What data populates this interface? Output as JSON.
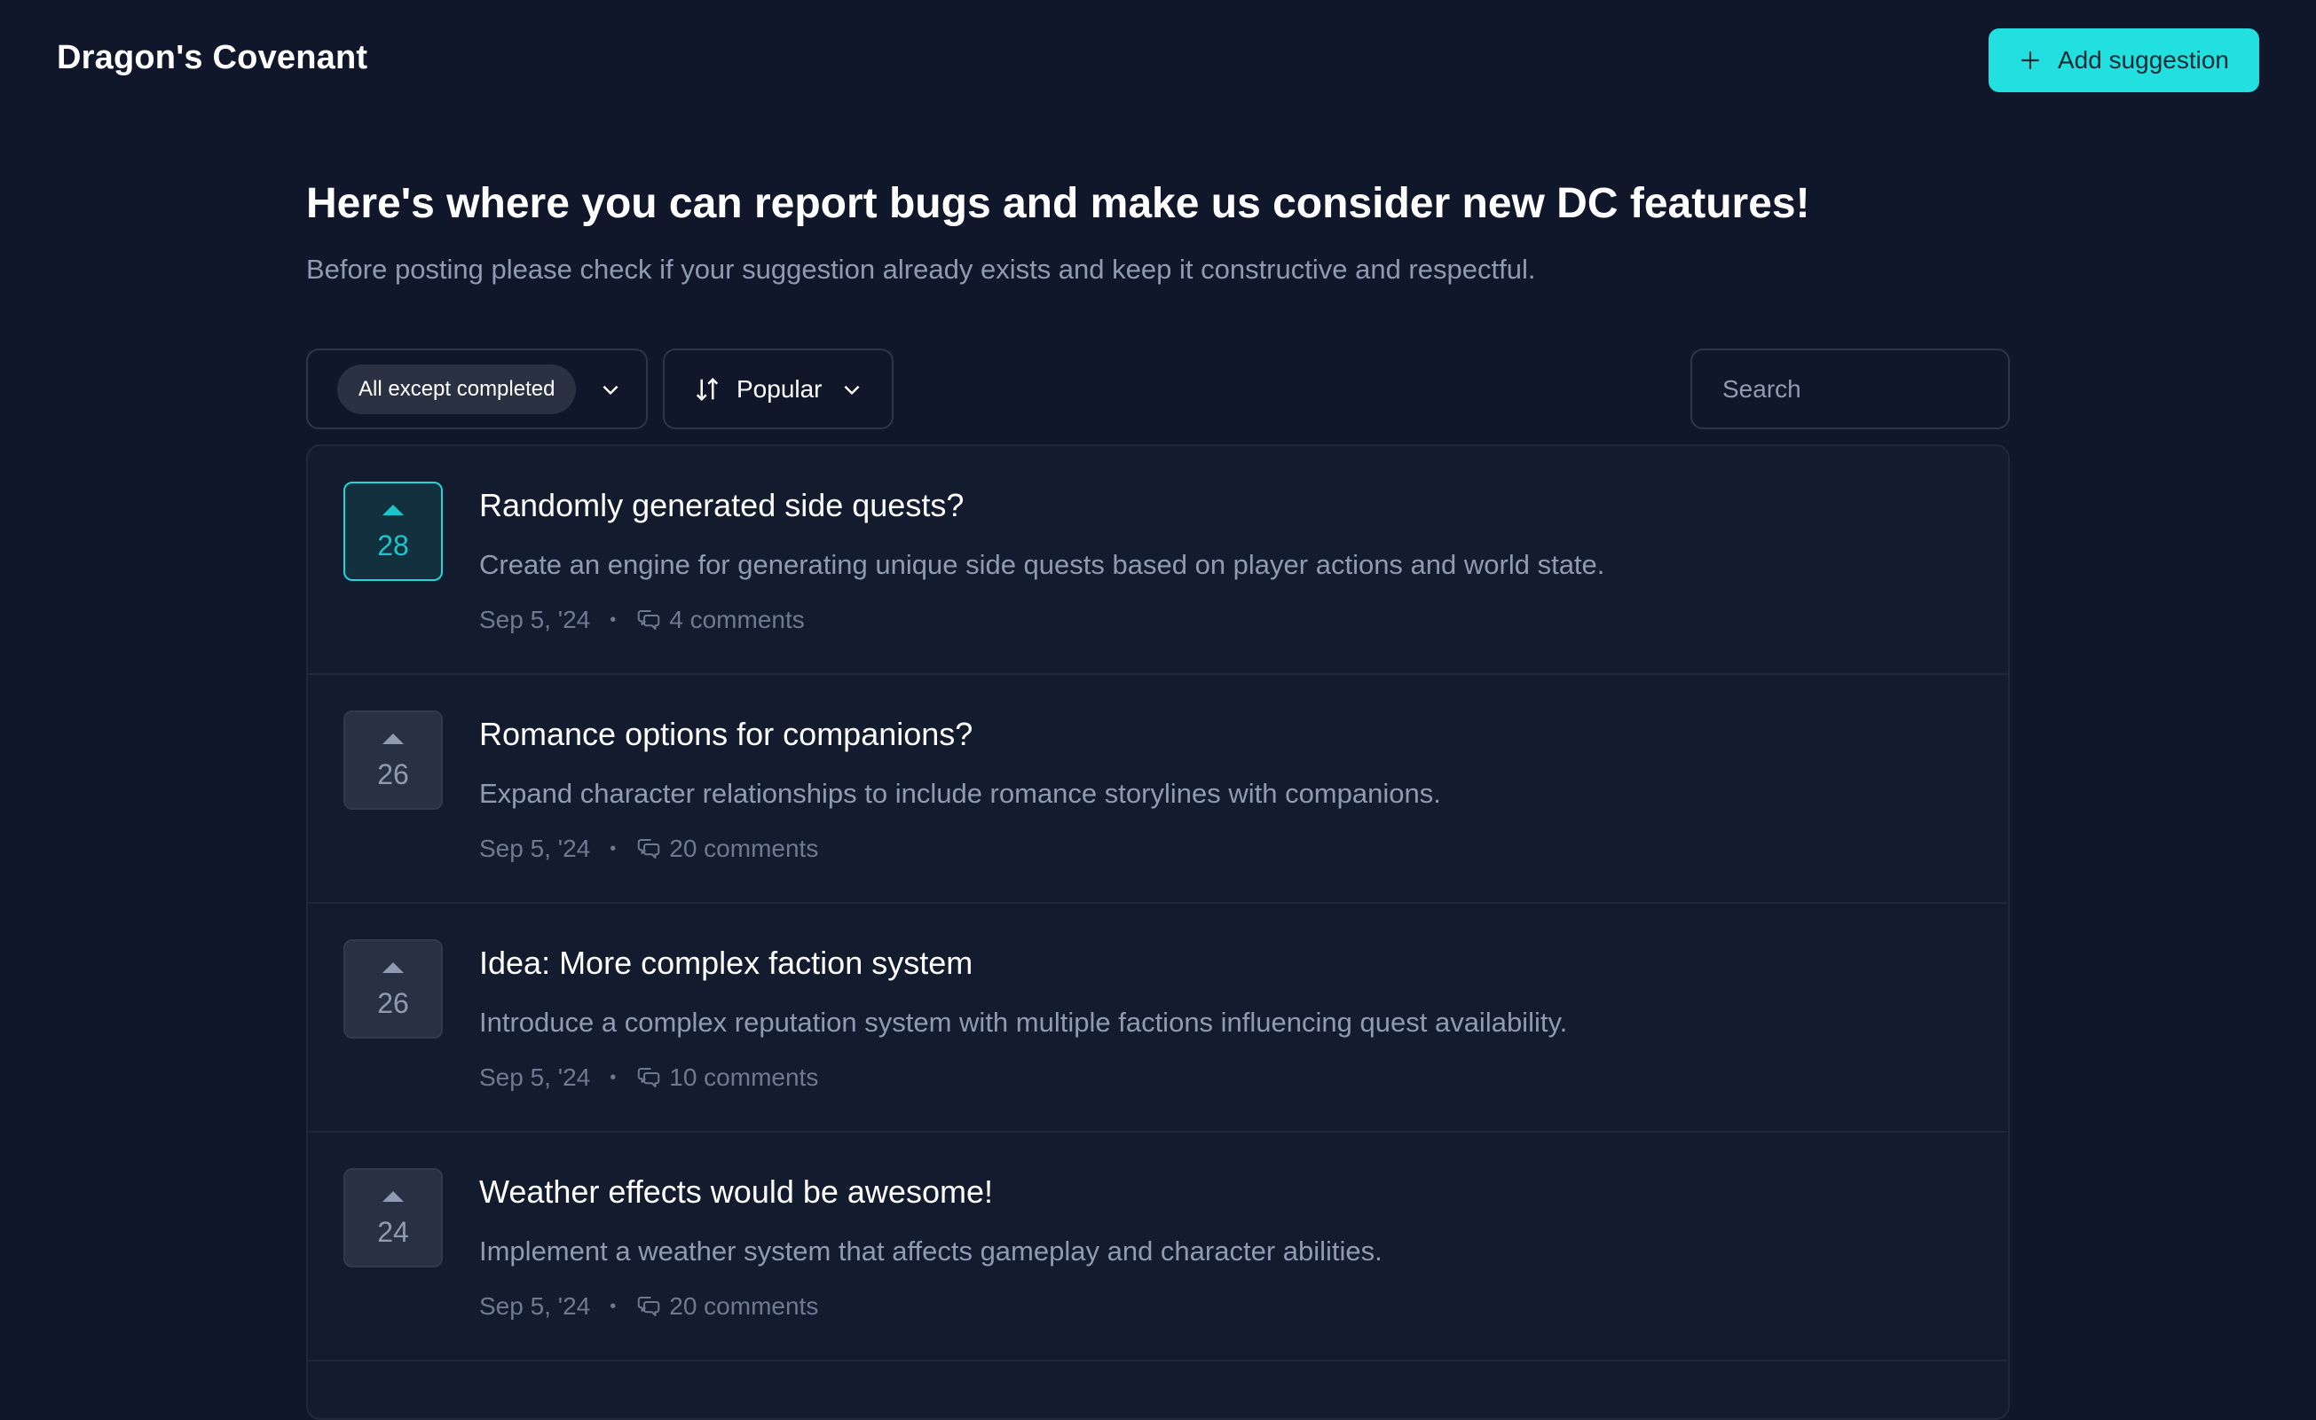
{
  "app": {
    "brand": "Dragon's Covenant",
    "add_button_label": "Add suggestion",
    "accent_color": "#22e0e0"
  },
  "intro": {
    "headline": "Here's where you can report bugs and make us consider new DC features!",
    "subline": "Before posting please check if your suggestion already exists and keep it constructive and respectful."
  },
  "toolbar": {
    "filter_selected": "All except completed",
    "sort_selected": "Popular",
    "search_placeholder": "Search",
    "search_value": ""
  },
  "suggestions": [
    {
      "votes": "28",
      "voted": true,
      "title": "Randomly generated side quests?",
      "description": "Create an engine for generating unique side quests based on player actions and world state.",
      "date": "Sep 5, '24",
      "separator": "•",
      "comments": "4 comments"
    },
    {
      "votes": "26",
      "voted": false,
      "title": "Romance options for companions?",
      "description": "Expand character relationships to include romance storylines with companions.",
      "date": "Sep 5, '24",
      "separator": "•",
      "comments": "20 comments"
    },
    {
      "votes": "26",
      "voted": false,
      "title": "Idea: More complex faction system",
      "description": "Introduce a complex reputation system with multiple factions influencing quest availability.",
      "date": "Sep 5, '24",
      "separator": "•",
      "comments": "10 comments"
    },
    {
      "votes": "24",
      "voted": false,
      "title": "Weather effects would be awesome!",
      "description": "Implement a weather system that affects gameplay and character abilities.",
      "date": "Sep 5, '24",
      "separator": "•",
      "comments": "20 comments"
    }
  ]
}
